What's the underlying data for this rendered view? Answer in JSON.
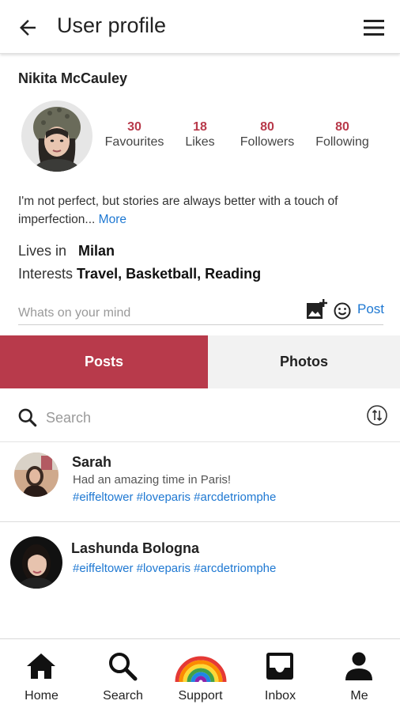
{
  "appbar": {
    "title": "User profile",
    "back_icon": "arrow-left-icon",
    "menu_icon": "hamburger-menu-icon"
  },
  "profile": {
    "name": "Nikita McCauley",
    "stats": [
      {
        "value": "30",
        "label": "Favourites"
      },
      {
        "value": "18",
        "label": "Likes"
      },
      {
        "value": "80",
        "label": "Followers"
      },
      {
        "value": "80",
        "label": "Following"
      }
    ],
    "bio": "I'm not perfect, but stories are always better with a touch of imperfection...",
    "bio_more": "More",
    "lives_in_label": "Lives in",
    "lives_in_value": "Milan",
    "interests_label": "Interests",
    "interests_value": "Travel, Basketball, Reading"
  },
  "composer": {
    "placeholder": "Whats on your mind",
    "post_label": "Post"
  },
  "tabs": [
    {
      "label": "Posts",
      "active": true
    },
    {
      "label": "Photos",
      "active": false
    }
  ],
  "search": {
    "placeholder": "Search"
  },
  "posts": [
    {
      "author": "Sarah",
      "text": "Had an amazing time in Paris!",
      "tags": "#eiffeltower #loveparis #arcdetriomphe"
    },
    {
      "author": "Lashunda Bologna",
      "text": "",
      "tags": "#eiffeltower #loveparis #arcdetriomphe"
    }
  ],
  "bottom_nav": [
    {
      "label": "Home",
      "icon": "home-icon"
    },
    {
      "label": "Search",
      "icon": "search-icon"
    },
    {
      "label": "Support",
      "icon": "rainbow-icon"
    },
    {
      "label": "Inbox",
      "icon": "inbox-icon"
    },
    {
      "label": "Me",
      "icon": "person-icon"
    }
  ],
  "colors": {
    "accent": "#b83a4b",
    "link": "#1e78d2",
    "tab_inactive_bg": "#f2f2f2"
  }
}
